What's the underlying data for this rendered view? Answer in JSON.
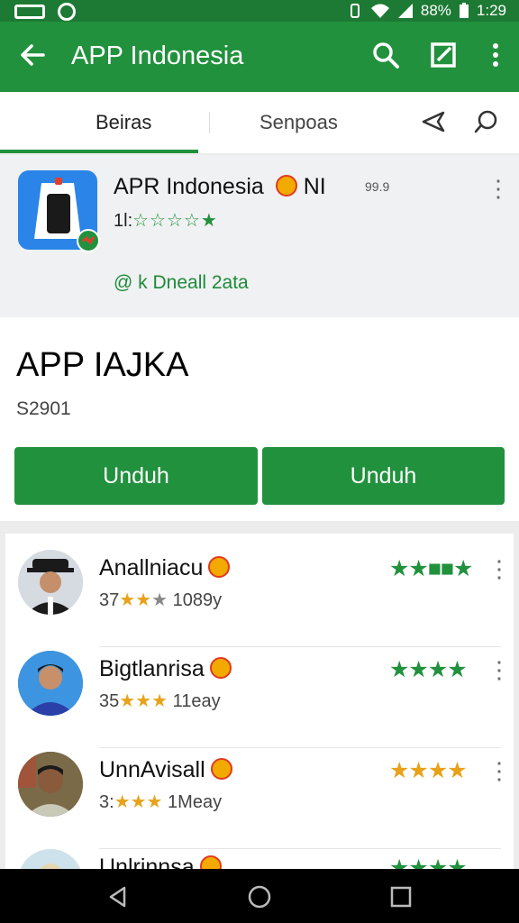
{
  "status": {
    "battery": "88%",
    "time": "1:29"
  },
  "appbar": {
    "title": "APP Indonesia"
  },
  "tabs": [
    {
      "label": "Beiras"
    },
    {
      "label": "Senpoas"
    }
  ],
  "app": {
    "name": "APR Indonesia",
    "suffix": "NI",
    "badge": "99.9",
    "rating_prefix": "1l:",
    "stars": "☆☆☆☆★",
    "download": "@ k Dneall 2ata"
  },
  "detail": {
    "heading": "APP IAJKA",
    "price": "S2901",
    "button_left": "Unduh",
    "button_right": "Unduh"
  },
  "reviews": [
    {
      "name": "Anallniacu",
      "meta_prefix": "37",
      "meta_stars": "★★",
      "meta_star_gray": "★",
      "meta_suffix": "1089y",
      "stars": "★★■■★",
      "star_color": "#21913d"
    },
    {
      "name": "Bigtlanrisa",
      "meta_prefix": "35",
      "meta_stars": "★★★",
      "meta_star_gray": "",
      "meta_suffix": "11eay",
      "stars": "★★★★",
      "star_color": "#21913d"
    },
    {
      "name": "UnnAvisall",
      "meta_prefix": "3:",
      "meta_stars": "★★★",
      "meta_star_gray": "",
      "meta_suffix": "1Meay",
      "stars": "★★★★",
      "star_color": "#e8a21a"
    },
    {
      "name": "Unlrinnsa",
      "meta_prefix": "",
      "meta_stars": "",
      "meta_star_gray": "",
      "meta_suffix": "",
      "stars": "★★★★",
      "star_color": "#21913d"
    }
  ],
  "colors": {
    "brand_green": "#21913d",
    "status_green": "#1d7a34",
    "star_gold": "#e8a21a",
    "app_icon_blue": "#2b85e8"
  },
  "icons": [
    "back-arrow-icon",
    "search-icon",
    "edit-icon",
    "more-vert-icon",
    "share-icon",
    "comment-icon",
    "back-triangle-icon",
    "home-circle-icon",
    "recents-square-icon"
  ]
}
